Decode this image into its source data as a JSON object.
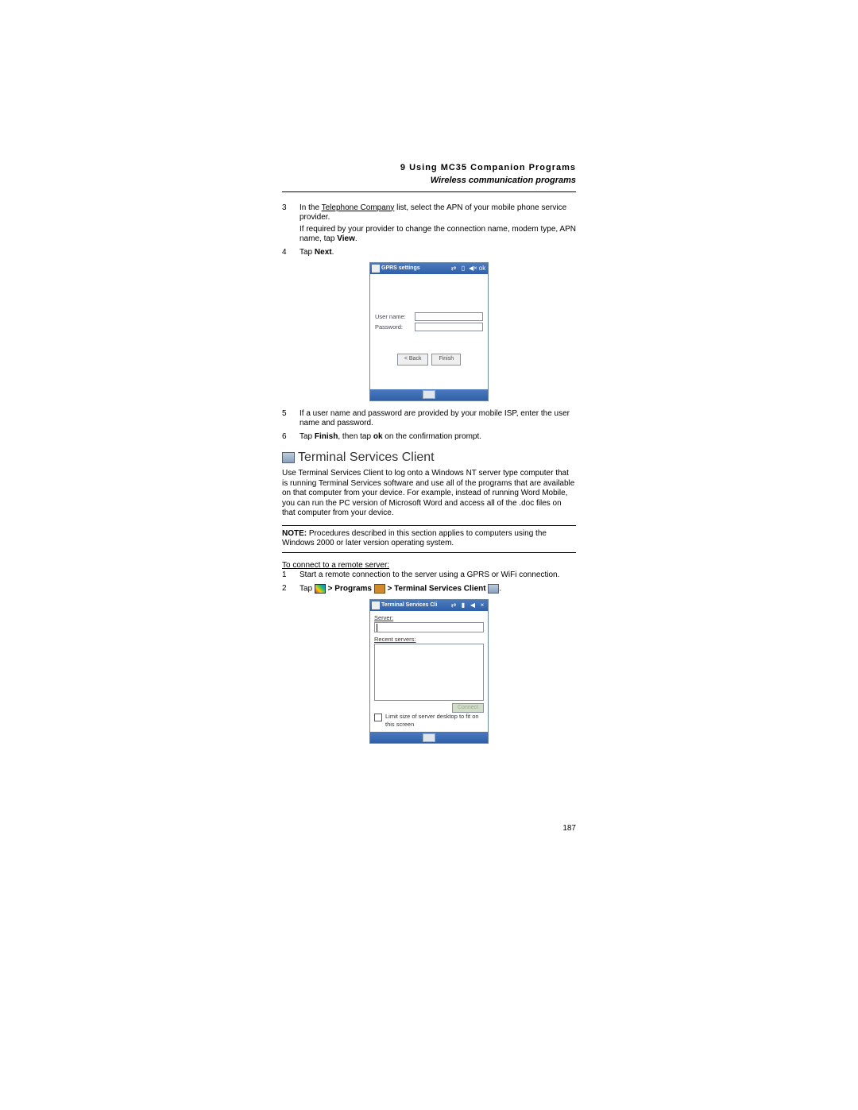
{
  "header": {
    "chapter": "9 Using MC35 Companion Programs",
    "section": "Wireless communication programs"
  },
  "steps1": {
    "s3a": "In the ",
    "s3b": "Telephone Company",
    "s3c": " list, select the APN of your mobile phone service provider.",
    "s3d": "If required by your provider to change the connection name, modem type, APN name, tap ",
    "s3e": "View",
    "s3f": ".",
    "s4a": "Tap ",
    "s4b": "Next",
    "s4c": "."
  },
  "shot1": {
    "title": "GPRS settings",
    "username_lbl": "User name:",
    "password_lbl": "Password:",
    "back_btn": "< Back",
    "finish_btn": "Finish"
  },
  "steps2": {
    "s5": "If a user name and password are provided by your mobile ISP, enter the user name and password.",
    "s6a": "Tap ",
    "s6b": "Finish",
    "s6c": ", then tap ",
    "s6d": "ok",
    "s6e": " on the confirmation prompt."
  },
  "ts": {
    "title": "Terminal Services Client",
    "body": "Use Terminal Services Client to log onto a Windows NT server type computer that is running Terminal Services software and use all of the programs that are available on that computer from your device. For example, instead of running Word Mobile, you can run the PC version of Microsoft Word and access all of the .doc files on that computer from your device.",
    "note_lbl": "NOTE: ",
    "note_txt": "  Procedures described in this section applies to computers using the Windows 2000 or later version operating system.",
    "proc_title": "To connect to a remote server:",
    "p1": "Start a remote connection to the server using a GPRS or WiFi connection.",
    "p2a": "Tap ",
    "p2b": " > Programs ",
    "p2c": " > Terminal Services Client ",
    "p2d": "."
  },
  "shot2": {
    "title": "Terminal Services Cli",
    "server_lbl": "Server:",
    "recent_lbl": "Recent servers:",
    "connect_btn": "Connect",
    "limit_txt": "Limit size of server desktop to fit on this screen"
  },
  "pagenum": "187"
}
